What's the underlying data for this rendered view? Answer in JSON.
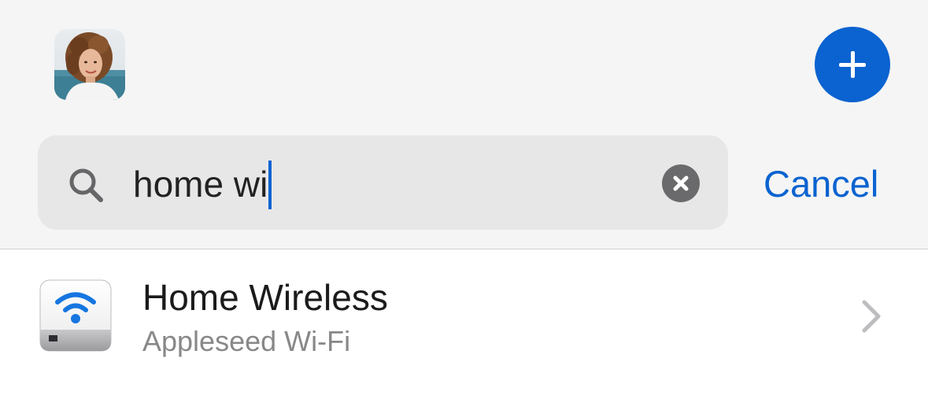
{
  "header": {
    "avatar_icon": "user-avatar-photo",
    "add_icon": "plus-icon",
    "accent_color": "#0a63d0"
  },
  "search": {
    "icon": "search-icon",
    "value": "home wi",
    "clear_icon": "clear-circle-icon",
    "cancel_label": "Cancel"
  },
  "results": [
    {
      "icon": "wifi-router-icon",
      "title": "Home Wireless",
      "subtitle": "Appleseed Wi-Fi",
      "chevron_icon": "chevron-right-icon"
    }
  ]
}
